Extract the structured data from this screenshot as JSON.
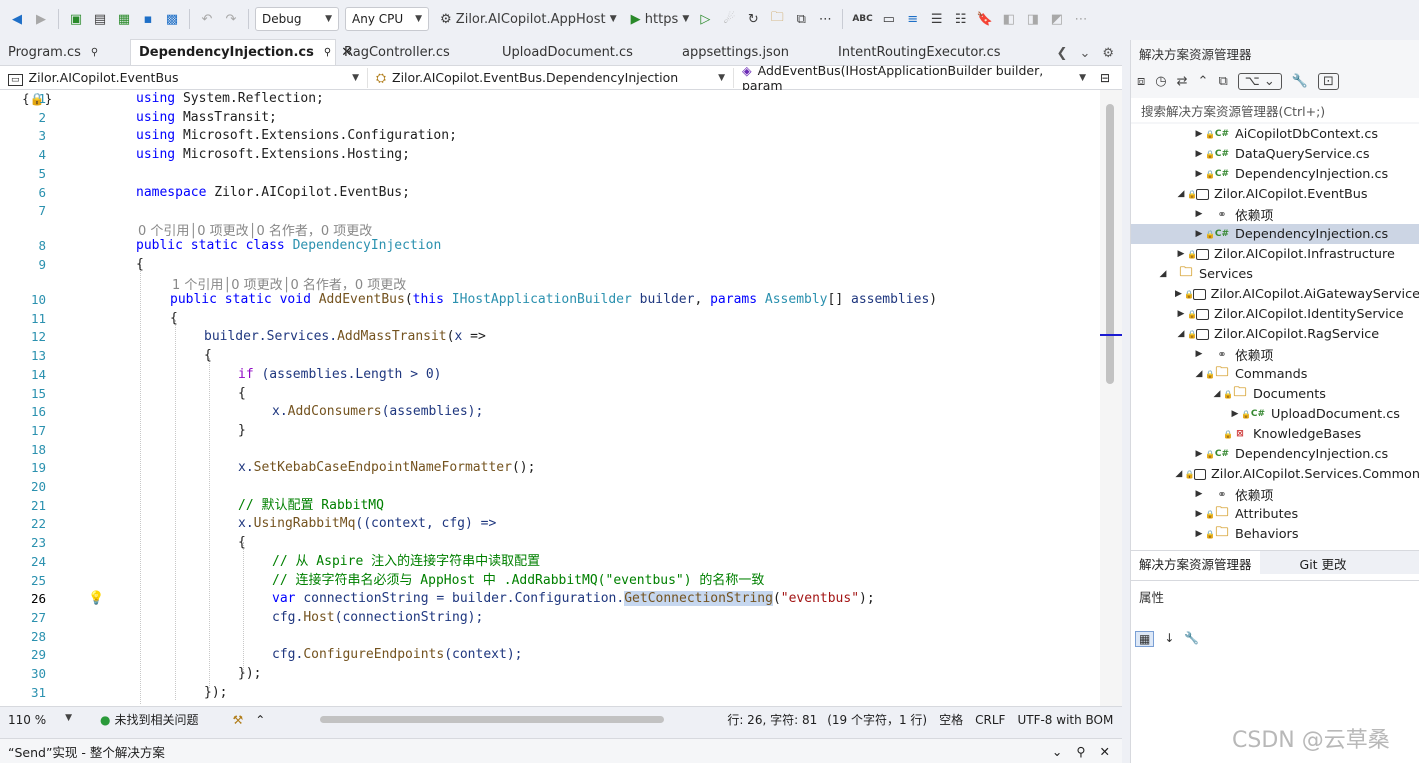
{
  "toolbar": {
    "config": "Debug",
    "platform": "Any CPU",
    "startup": "Zilor.AICopilot.AppHost",
    "run": "https"
  },
  "tabs": [
    {
      "label": "Program.cs",
      "pin": "📌"
    },
    {
      "label": "DependencyInjection.cs",
      "pin": "📌",
      "close": "✕"
    },
    {
      "label": "RagController.cs"
    },
    {
      "label": "UploadDocument.cs"
    },
    {
      "label": "appsettings.json"
    },
    {
      "label": "IntentRoutingExecutor.cs"
    }
  ],
  "nav": {
    "project": "Zilor.AICopilot.EventBus",
    "type": "Zilor.AICopilot.EventBus.DependencyInjection",
    "member": "AddEventBus(IHostApplicationBuilder builder, param"
  },
  "code": {
    "l1": "1",
    "l2": "2",
    "l3": "3",
    "l4": "4",
    "l5": "5",
    "l6": "6",
    "l7": "7",
    "l8": "8",
    "l9": "9",
    "l10": "10",
    "l11": "11",
    "l12": "12",
    "l13": "13",
    "l14": "14",
    "l15": "15",
    "l16": "16",
    "l17": "17",
    "l18": "18",
    "l19": "19",
    "l20": "20",
    "l21": "21",
    "l22": "22",
    "l23": "23",
    "l24": "24",
    "l25": "25",
    "l26": "26",
    "l27": "27",
    "l28": "28",
    "l29": "29",
    "l30": "30",
    "l31": "31",
    "lens1": "0 个引用│0 项更改│0 名作者，0 项更改",
    "lens2": "1 个引用│0 项更改│0 名作者，0 项更改",
    "using": "using",
    "u1": "System.Reflection;",
    "u2": "MassTransit;",
    "u3": "Microsoft.Extensions.Configuration;",
    "u4": "Microsoft.Extensions.Hosting;",
    "namespace": "namespace",
    "ns": "Zilor.AICopilot.EventBus;",
    "public": "public",
    "static": "static",
    "class": "class",
    "className": "DependencyInjection",
    "void": "void",
    "method": "AddEventBus",
    "this": "this",
    "ihab": "IHostApplicationBuilder",
    "builder": "builder",
    "params": "params",
    "assembly": "Assembly",
    "arr": "[]",
    "assemblies": "assemblies",
    "c12a": "builder.Services.",
    "c12b": "AddMassTransit",
    "c12c": "(",
    "c12x": "x",
    "c12d": " =>",
    "if": "if",
    "c14": "(assemblies.Length > 0)",
    "c16a": "x.",
    "c16b": "AddConsumers",
    "c16c": "(assemblies);",
    "c19a": "x.",
    "c19b": "SetKebabCaseEndpointNameFormatter",
    "c19c": "();",
    "cm20": "// 默认配置 RabbitMQ",
    "c22a": "x.",
    "c22b": "UsingRabbitMq",
    "c22c": "((context, cfg) =>",
    "cm24": "// 从 Aspire 注入的连接字符串中读取配置",
    "cm25": "// 连接字符串名必须与 AppHost 中 .AddRabbitMQ(\"eventbus\") 的名称一致",
    "var": "var",
    "c26a": "connectionString = builder.Configuration.",
    "c26b": "GetConnectionString",
    "c26c": "(",
    "c26s": "\"eventbus\"",
    "c26d": ");",
    "c27a": "cfg.",
    "c27b": "Host",
    "c27c": "(connectionString);",
    "c29a": "cfg.",
    "c29b": "ConfigureEndpoints",
    "c29c": "(context);",
    "ob": "{",
    "cb": "}",
    "c30": "});",
    "c31": "});"
  },
  "status": {
    "zoom": "110 %",
    "issues": "未找到相关问题",
    "position": "行: 26, 字符: 81",
    "selection": "(19 个字符，1 行)",
    "whitespace": "空格",
    "eol": "CRLF",
    "encoding": "UTF-8 with BOM"
  },
  "bottom": {
    "title": "“Send”实现 - 整个解决方案"
  },
  "solution": {
    "title": "解决方案资源管理器",
    "search": "搜索解决方案资源管理器(Ctrl+;)",
    "nodes": [
      "AiCopilotDbContext.cs",
      "DataQueryService.cs",
      "DependencyInjection.cs",
      "Zilor.AICopilot.EventBus",
      "依赖项",
      "DependencyInjection.cs",
      "Zilor.AICopilot.Infrastructure",
      "Services",
      "Zilor.AICopilot.AiGatewayService",
      "Zilor.AICopilot.IdentityService",
      "Zilor.AICopilot.RagService",
      "依赖项",
      "Commands",
      "Documents",
      "UploadDocument.cs",
      "KnowledgeBases",
      "DependencyInjection.cs",
      "Zilor.AICopilot.Services.Common",
      "依赖项",
      "Attributes",
      "Behaviors"
    ],
    "tab1": "解决方案资源管理器",
    "tab2": "Git 更改",
    "props": "属性"
  },
  "watermark": "CSDN @云草桑"
}
